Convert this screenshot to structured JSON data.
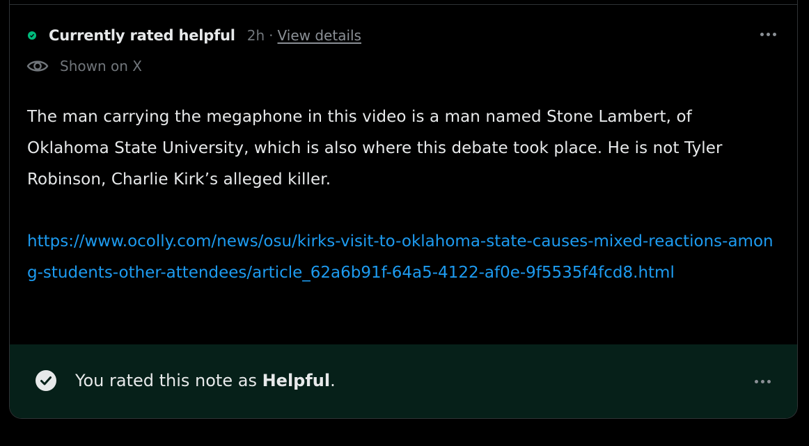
{
  "note": {
    "status": {
      "label": "Currently rated helpful",
      "color": "#00ba7c",
      "time": "2h",
      "separator": "·",
      "view_details_label": "View details"
    },
    "visibility": {
      "icon": "eye-icon",
      "label": "Shown on X"
    },
    "body_text": "The man carrying the megaphone in this video is a man named Stone Lambert, of Oklahoma State University, which is also where this debate took place. He is not Tyler Robinson, Charlie Kirk’s alleged killer.",
    "link": "https://www.ocolly.com/news/osu/kirks-visit-to-oklahoma-state-causes-mixed-reactions-among-students-other-attendees/article_62a6b91f-64a5-4122-af0e-9f5535f4fcd8.html",
    "more_icon": "more-horizontal-icon"
  },
  "rating": {
    "icon": "check-circle-icon",
    "prefix": "You rated this note as ",
    "value": "Helpful",
    "suffix": ".",
    "background": "#062019"
  }
}
